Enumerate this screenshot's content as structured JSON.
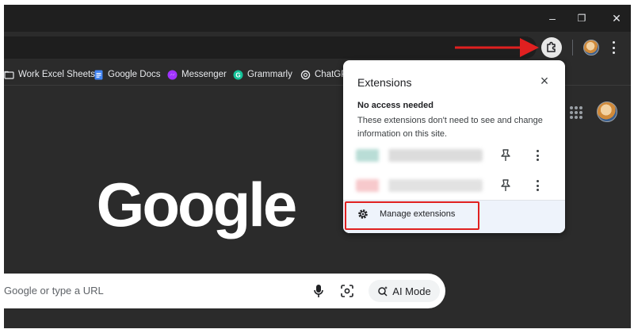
{
  "browser": {
    "window_controls": {
      "minimize": "–",
      "restore": "❐",
      "close": "✕"
    }
  },
  "bookmarks": [
    {
      "label": "Work Excel Sheets",
      "icon": "folder-icon",
      "color": "#e8eaed"
    },
    {
      "label": "Google Docs",
      "icon": "google-docs-icon",
      "color": "#4285f4"
    },
    {
      "label": "Messenger",
      "icon": "messenger-icon",
      "color": "#a033ff"
    },
    {
      "label": "Grammarly",
      "icon": "grammarly-icon",
      "color": "#15c39a"
    },
    {
      "label": "ChatGP",
      "icon": "chatgpt-icon",
      "color": "#e8eaed"
    }
  ],
  "page": {
    "logo": "Google",
    "search_placeholder": "Google or type a URL",
    "ai_mode_label": "AI Mode"
  },
  "extensions_popup": {
    "title": "Extensions",
    "section_title": "No access needed",
    "section_desc": "These extensions don't need to see and change information on this site.",
    "items": [
      {
        "name_blurred": true,
        "colors": [
          "#b9ddd6",
          "#dcdcdc"
        ]
      },
      {
        "name_blurred": true,
        "colors": [
          "#f7c9cc",
          "#e2e2e2"
        ]
      }
    ],
    "manage_label": "Manage extensions"
  },
  "annotation": {
    "arrow_color": "#e02020",
    "highlight_color": "#e02020"
  }
}
